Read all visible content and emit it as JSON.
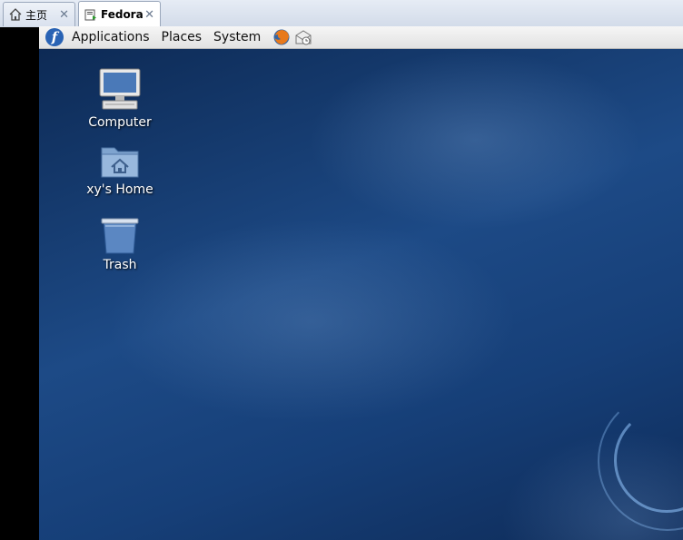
{
  "vm_tabs": [
    {
      "label": "主页",
      "icon": "home-icon",
      "active": false
    },
    {
      "label": "Fedora",
      "icon": "vm-icon",
      "active": true
    }
  ],
  "panel": {
    "menus": [
      "Applications",
      "Places",
      "System"
    ],
    "launchers": [
      "firefox-icon",
      "mail-clock-icon"
    ]
  },
  "desktop": {
    "icons": [
      {
        "label": "Computer",
        "icon": "computer-icon"
      },
      {
        "label": "xy's Home",
        "icon": "home-folder-icon"
      },
      {
        "label": "Trash",
        "icon": "trash-icon"
      }
    ]
  }
}
